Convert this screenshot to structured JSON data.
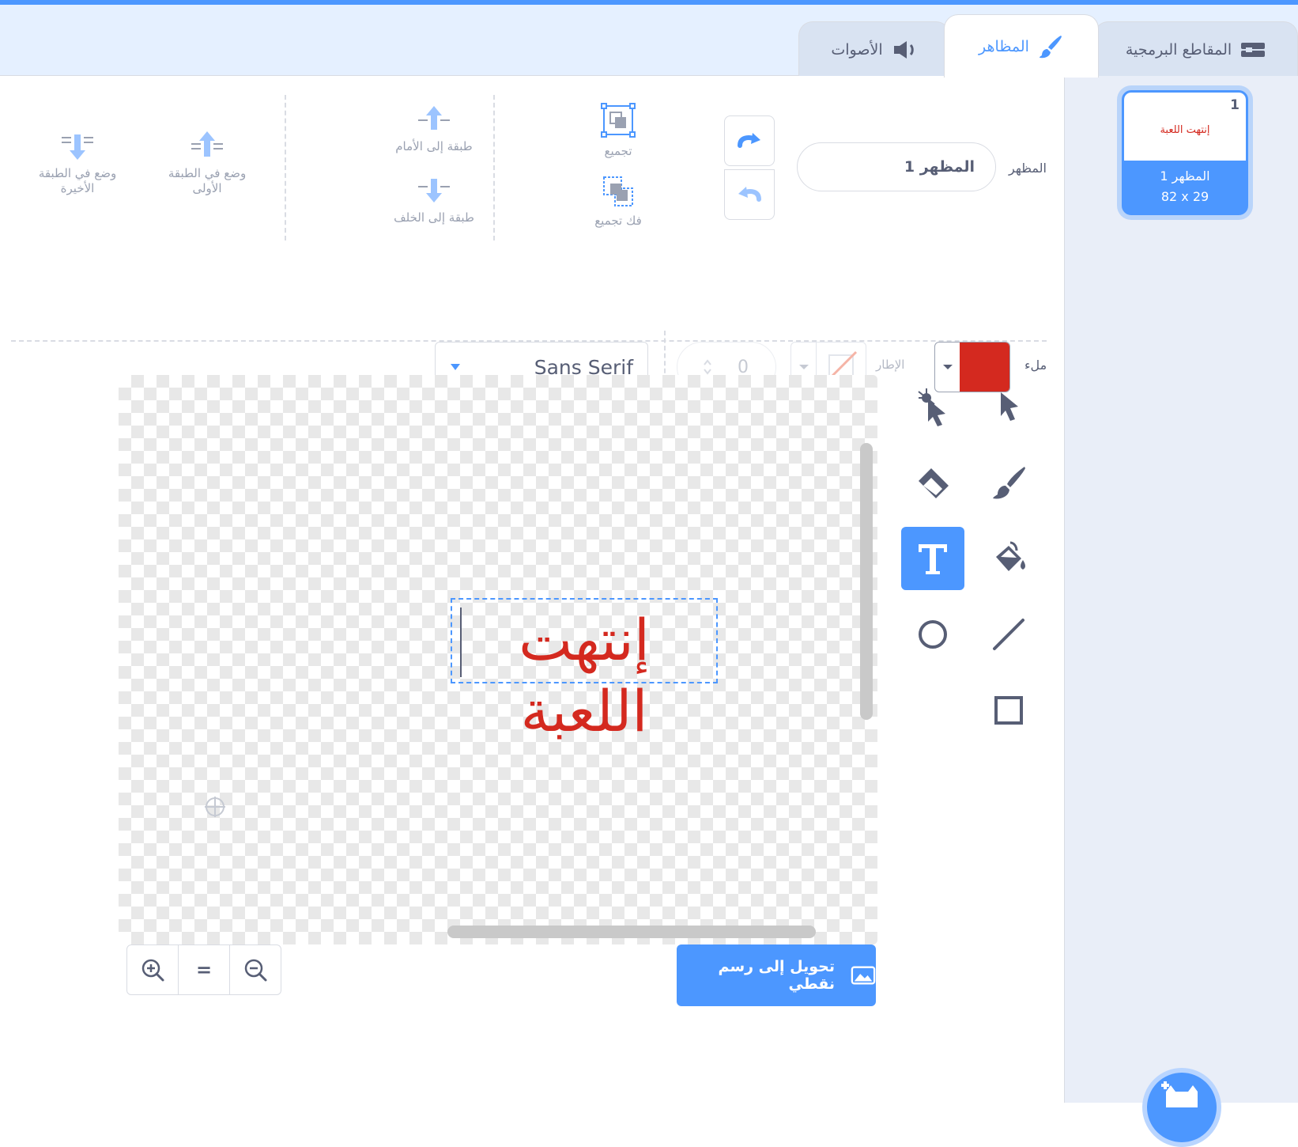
{
  "tabs": {
    "code": "المقاطع البرمجية",
    "costumes": "المظاهر",
    "sounds": "الأصوات"
  },
  "costume_list": [
    {
      "number": "1",
      "name": "المظهر 1",
      "size": "82 x 29",
      "thumb_text": "إنتهت اللعبة"
    }
  ],
  "editor": {
    "costume_label": "المظهر",
    "costume_name": "المظهر 1",
    "actions": {
      "group": "تجميع",
      "ungroup": "فك تجميع",
      "forward": "طبقة إلى الأمام",
      "backward": "طبقة إلى الخلف",
      "front": "وضع في الطبقة الأولى",
      "back": "وضع في الطبقة الأخيرة"
    },
    "fill_label": "ملء",
    "fill_color": "#d4291f",
    "outline_label": "الإطار",
    "stroke_width": "0",
    "font": "Sans Serif",
    "canvas_text": "إنتهت اللعبة",
    "active_tool": "text",
    "convert_button": "تحويل إلى رسم نقطي",
    "zoom_reset_label": "="
  },
  "colors": {
    "accent": "#4c97ff",
    "text": "#575e75"
  }
}
